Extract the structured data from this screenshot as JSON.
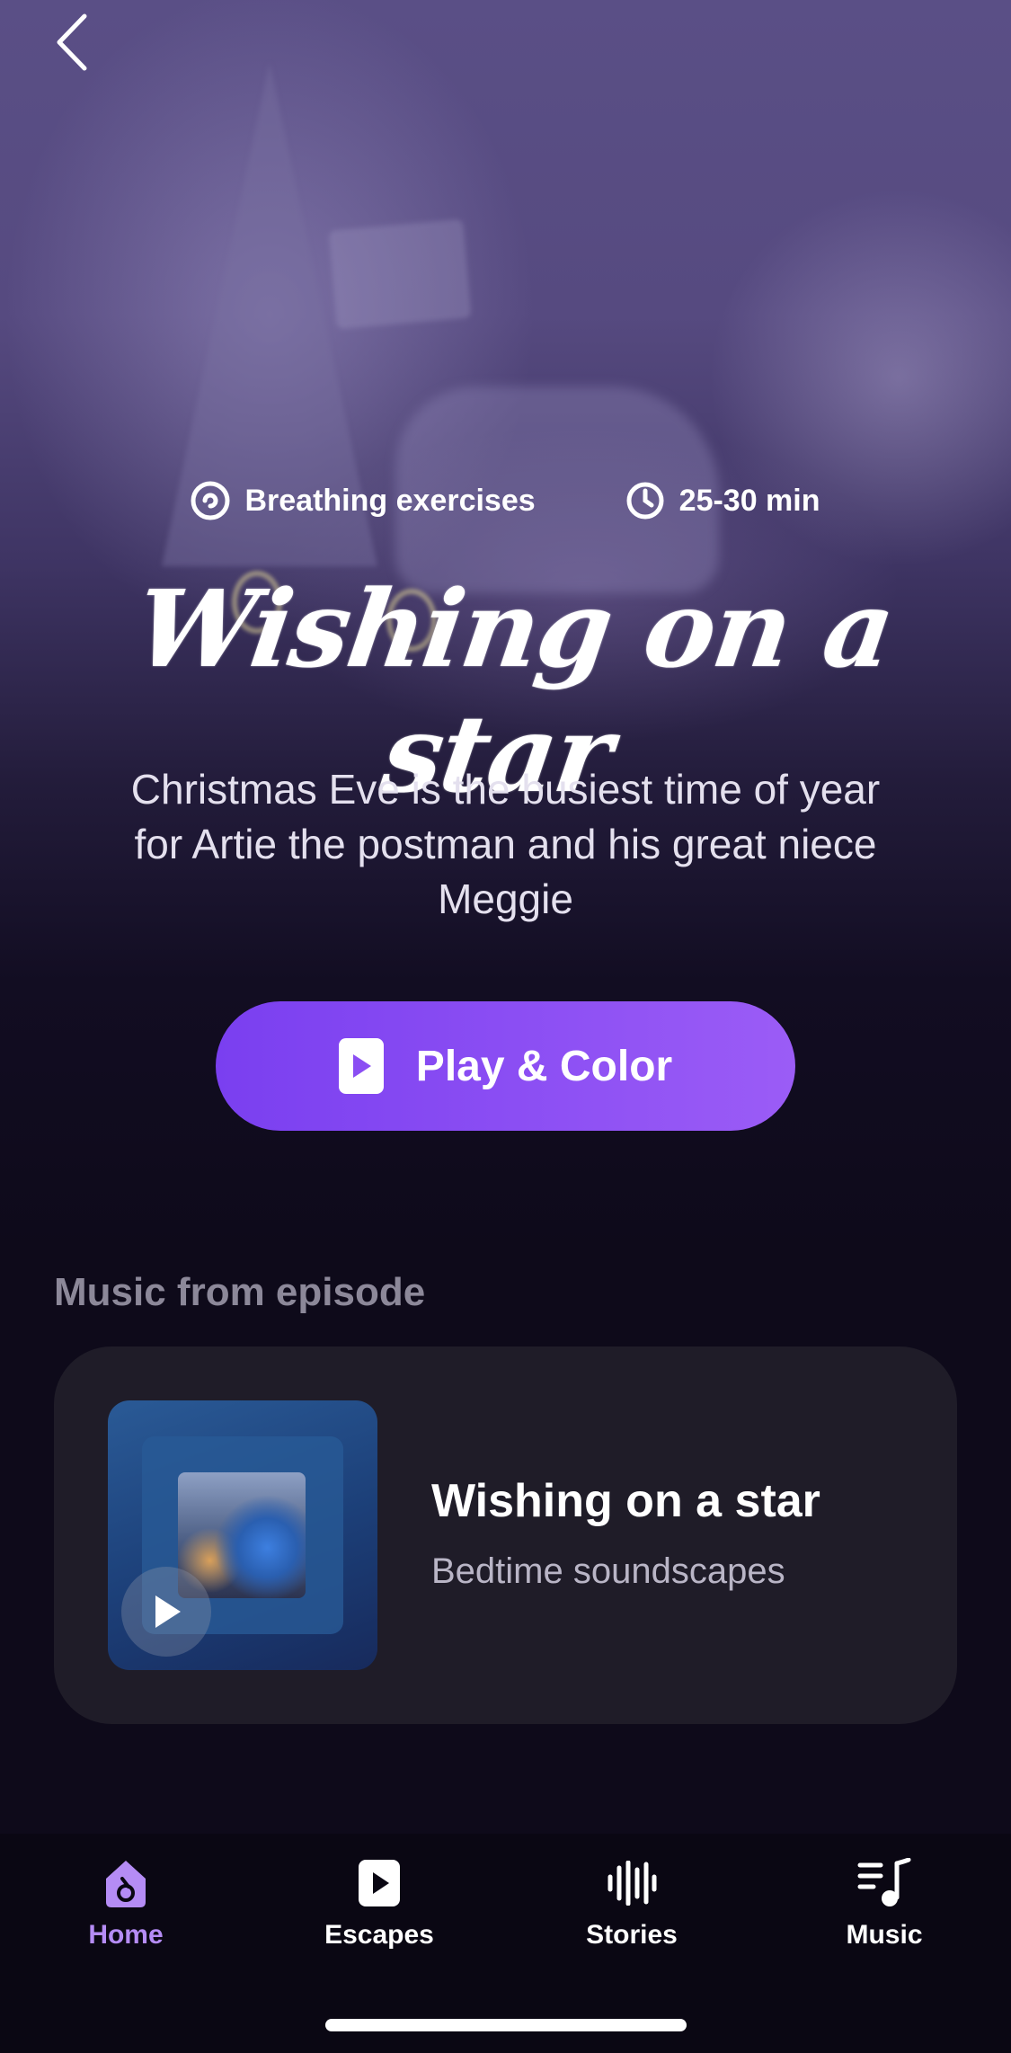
{
  "hero": {
    "meta": [
      {
        "icon": "spiral-icon",
        "label": "Breathing exercises"
      },
      {
        "icon": "clock-icon",
        "label": "25-30 min"
      }
    ],
    "title": "Wishing on a star",
    "description": "Christmas Eve is the busiest time of year for Artie the postman and his great niece Meggie",
    "play_button_label": "Play & Color",
    "accent_color": "#8b4ef3"
  },
  "music_section": {
    "title": "Music from episode",
    "track": {
      "title": "Wishing on a star",
      "subtitle": "Bedtime soundscapes"
    }
  },
  "tabbar": {
    "active_color": "#b58cf5",
    "items": [
      {
        "icon": "home-icon",
        "label": "Home",
        "active": true
      },
      {
        "icon": "play-square-icon",
        "label": "Escapes",
        "active": false
      },
      {
        "icon": "sound-wave-icon",
        "label": "Stories",
        "active": false
      },
      {
        "icon": "music-note-icon",
        "label": "Music",
        "active": false
      }
    ]
  }
}
